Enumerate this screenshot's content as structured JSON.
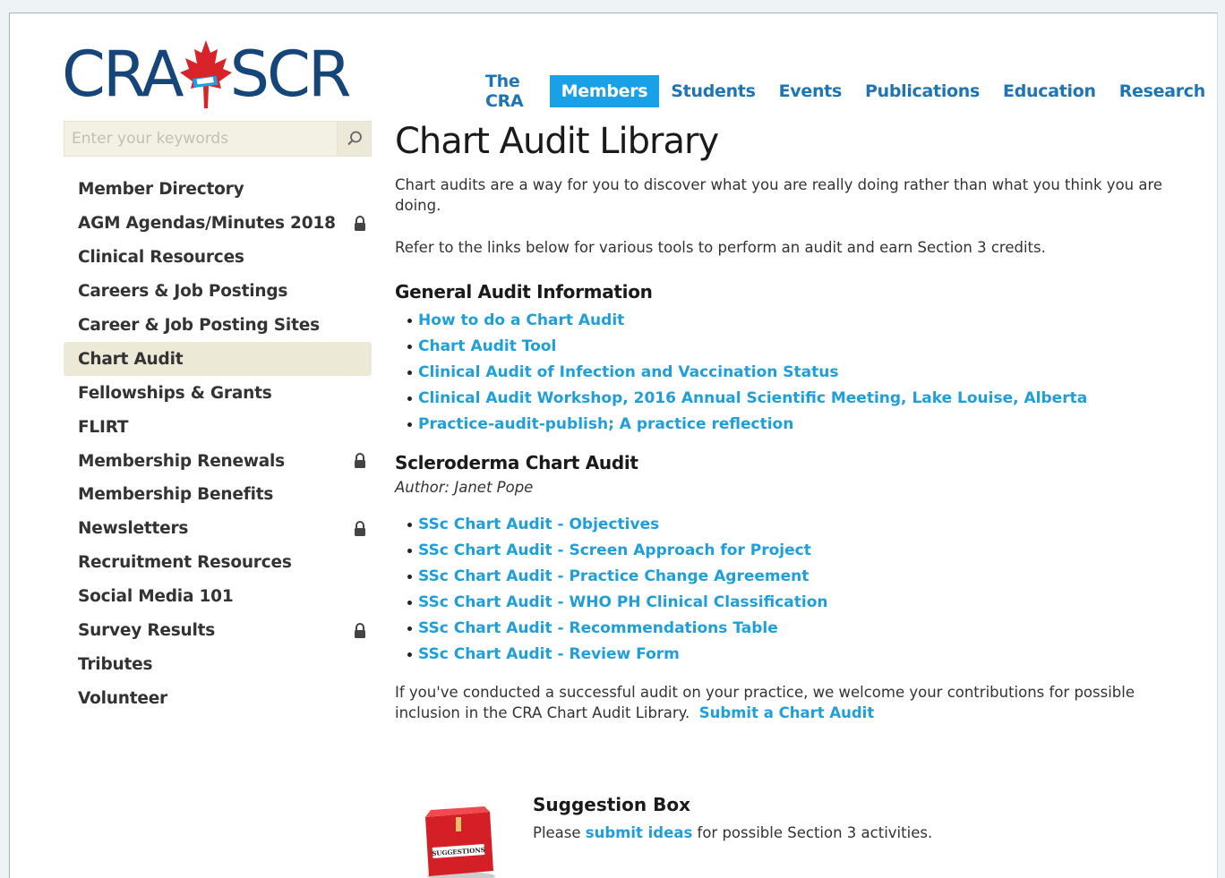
{
  "logo": {
    "left": "CRA",
    "right": "SCR"
  },
  "topnav": [
    {
      "label": "The CRA",
      "active": false
    },
    {
      "label": "Members",
      "active": true
    },
    {
      "label": "Students",
      "active": false
    },
    {
      "label": "Events",
      "active": false
    },
    {
      "label": "Publications",
      "active": false
    },
    {
      "label": "Education",
      "active": false
    },
    {
      "label": "Research",
      "active": false
    }
  ],
  "search": {
    "placeholder": "Enter your keywords",
    "icon": "search-icon"
  },
  "sidebar": {
    "items": [
      {
        "label": "Member Directory",
        "locked": false,
        "active": false
      },
      {
        "label": "AGM Agendas/Minutes 2018",
        "locked": true,
        "active": false
      },
      {
        "label": "Clinical Resources",
        "locked": false,
        "active": false
      },
      {
        "label": "Careers & Job Postings",
        "locked": false,
        "active": false
      },
      {
        "label": "Career & Job Posting Sites",
        "locked": false,
        "active": false
      },
      {
        "label": "Chart Audit",
        "locked": false,
        "active": true
      },
      {
        "label": "Fellowships & Grants",
        "locked": false,
        "active": false
      },
      {
        "label": "FLIRT",
        "locked": false,
        "active": false
      },
      {
        "label": "Membership Renewals",
        "locked": true,
        "active": false
      },
      {
        "label": "Membership Benefits",
        "locked": false,
        "active": false
      },
      {
        "label": "Newsletters",
        "locked": true,
        "active": false
      },
      {
        "label": "Recruitment Resources",
        "locked": false,
        "active": false
      },
      {
        "label": "Social Media 101",
        "locked": false,
        "active": false
      },
      {
        "label": "Survey Results",
        "locked": true,
        "active": false
      },
      {
        "label": "Tributes",
        "locked": false,
        "active": false
      },
      {
        "label": "Volunteer",
        "locked": false,
        "active": false
      }
    ]
  },
  "main": {
    "title": "Chart Audit Library",
    "intro1": "Chart audits are a way for you to discover what you are really doing rather than what you think you are doing.",
    "intro2": "Refer to the links below for various tools to perform an audit and earn Section 3 credits.",
    "general": {
      "heading": "General Audit Information",
      "links": [
        "How to do a Chart Audit",
        "Chart Audit Tool",
        "Clinical Audit of Infection and Vaccination Status",
        "Clinical Audit Workshop, 2016 Annual Scientific Meeting, Lake Louise, Alberta",
        "Practice-audit-publish; A practice reflection"
      ]
    },
    "scleroderma": {
      "heading": "Scleroderma Chart Audit",
      "author": "Author: Janet Pope",
      "links": [
        "SSc Chart Audit - Objectives",
        "SSc Chart Audit - Screen Approach for Project",
        "SSc Chart Audit - Practice Change Agreement",
        "SSc Chart Audit - WHO PH Clinical Classification",
        "SSc Chart Audit - Recommendations Table",
        "SSc Chart Audit - Review Form"
      ]
    },
    "closing_text": "If you've conducted a successful audit on your practice, we welcome your contributions for possible inclusion in the CRA Chart Audit Library.",
    "closing_link": "Submit a Chart Audit"
  },
  "suggestion": {
    "title": "Suggestion Box",
    "text_before": "Please",
    "link": "submit ideas",
    "text_after": "for possible Section 3 activities.",
    "box_label": "SUGGESTIONS"
  },
  "colors": {
    "brand": "#16457a",
    "link": "#1e9fdc",
    "nav_active": "#1aa0e6",
    "leaf_red": "#d8232a"
  }
}
